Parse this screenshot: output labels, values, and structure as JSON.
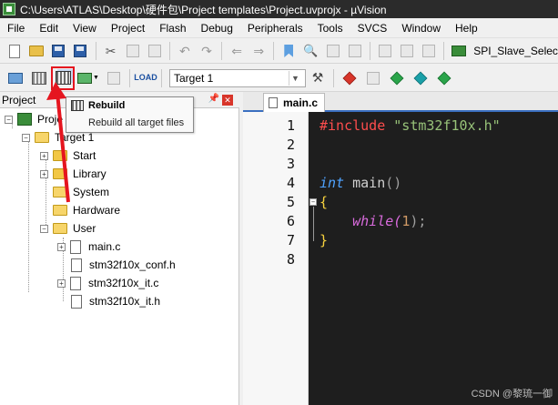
{
  "window": {
    "title": "C:\\Users\\ATLAS\\Desktop\\硬件包\\Project templates\\Project.uvprojx - µVision"
  },
  "menu": [
    "File",
    "Edit",
    "View",
    "Project",
    "Flash",
    "Debug",
    "Peripherals",
    "Tools",
    "SVCS",
    "Window",
    "Help"
  ],
  "toolbar": {
    "target": "Target 1",
    "config_name": "SPI_Slave_Selec",
    "load_label": "LOAD"
  },
  "tooltip": {
    "title": "Rebuild",
    "description": "Rebuild all target files"
  },
  "project_panel": {
    "title": "Project",
    "project_name_partial": "Proje",
    "target": "Target 1",
    "groups": [
      "Start",
      "Library",
      "System",
      "Hardware",
      "User"
    ],
    "user_files": [
      "main.c",
      "stm32f10x_conf.h",
      "stm32f10x_it.c",
      "stm32f10x_it.h"
    ]
  },
  "editor": {
    "tab": "main.c",
    "line_numbers": [
      "1",
      "2",
      "3",
      "4",
      "5",
      "6",
      "7",
      "8"
    ],
    "code": {
      "l1_directive": "#include",
      "l1_string": "\"stm32f10x.h\"",
      "l4_type": "int",
      "l4_name": " main",
      "l4_parens": "()",
      "l5_brace": "{",
      "l6_kw": "while",
      "l6_open": "(",
      "l6_num": "1",
      "l6_close": ");",
      "l7_brace": "}"
    }
  },
  "watermark": "CSDN @黎琉一御",
  "colors": {
    "editor_bg": "#1e1e1e",
    "highlight": "#e5151f",
    "titlebar": "#2b2b2b"
  }
}
